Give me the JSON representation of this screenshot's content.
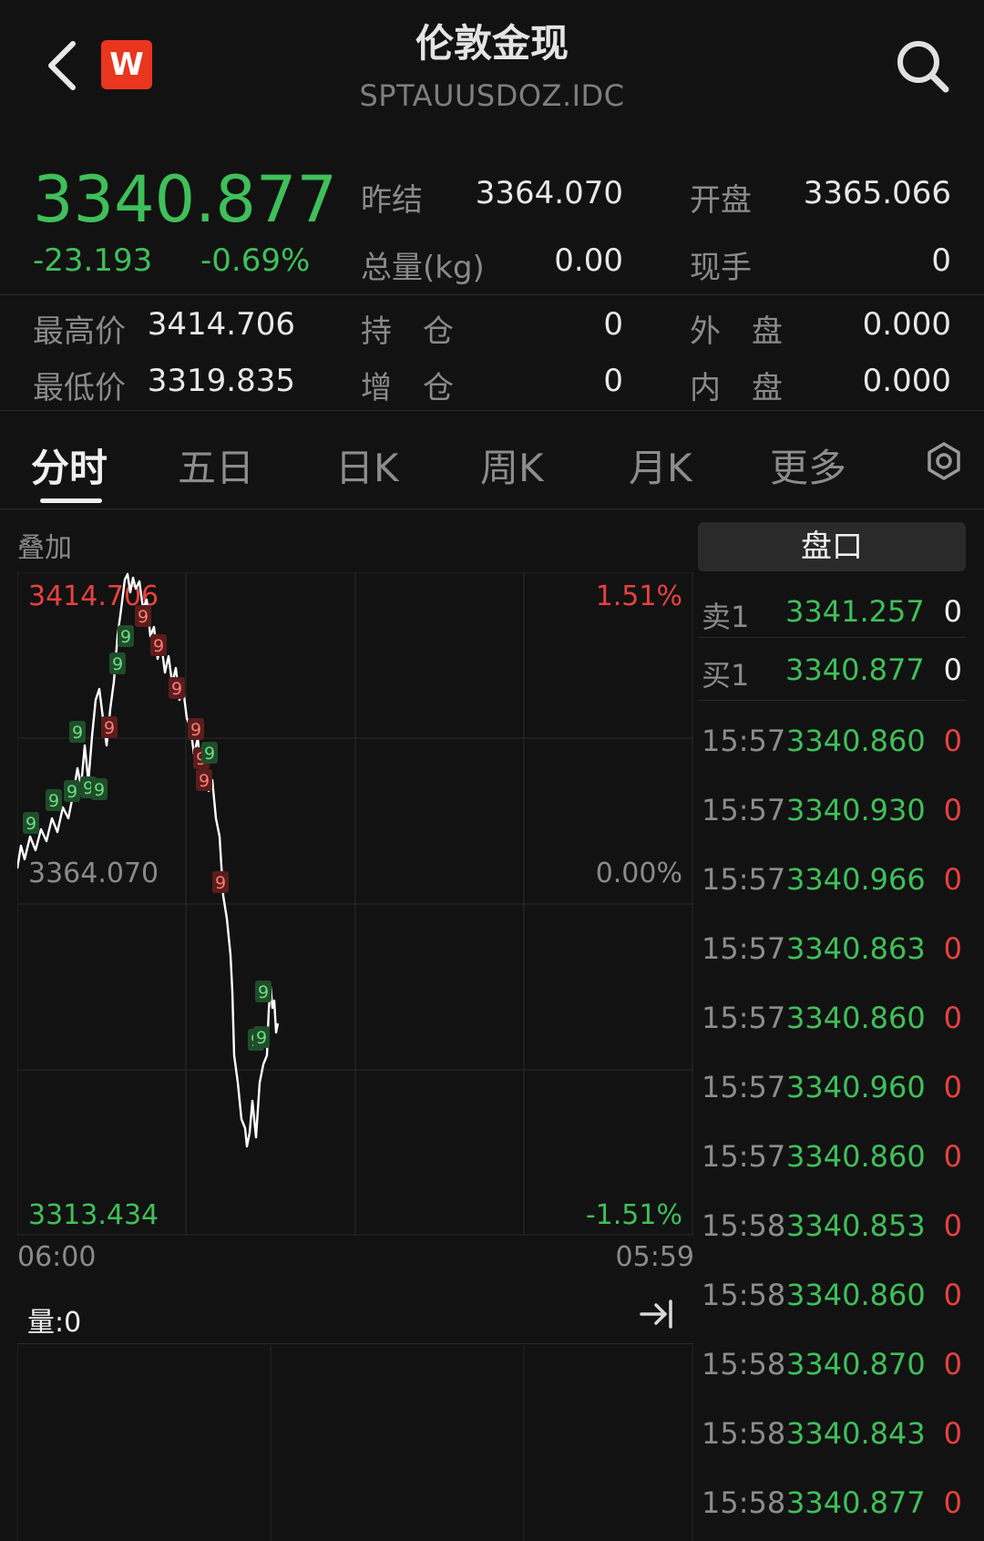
{
  "header": {
    "title": "伦敦金现",
    "subtitle": "SPTAUUSDOZ.IDC",
    "logo_text": "W",
    "back_icon": "chevron-left-icon",
    "search_icon": "search-icon"
  },
  "quote": {
    "price": "3340.877",
    "change": "-23.193",
    "change_pct": "-0.69%",
    "rows": [
      {
        "l1": "昨结",
        "v1": "3364.070",
        "l2": "开盘",
        "v2": "3365.066"
      },
      {
        "l1": "总量(kg)",
        "v1": "0.00",
        "l2": "现手",
        "v2": "0"
      }
    ],
    "stats": [
      {
        "l0": "最高价",
        "v0": "3414.706",
        "l1": "持　仓",
        "v1": "0",
        "l2": "外　盘",
        "v2": "0.000"
      },
      {
        "l0": "最低价",
        "v0": "3319.835",
        "l1": "增　仓",
        "v1": "0",
        "l2": "内　盘",
        "v2": "0.000"
      }
    ]
  },
  "tabs": [
    "分时",
    "五日",
    "日K",
    "周K",
    "月K",
    "更多"
  ],
  "active_tab": "分时",
  "settings_icon": "settings-icon",
  "chart": {
    "overlay_label": "叠加",
    "high_price": "3414.706",
    "high_pct": "1.51%",
    "ref_price": "3364.070",
    "ref_pct": "0.00%",
    "low_price": "3313.434",
    "low_pct": "-1.51%",
    "time_start": "06:00",
    "time_end": "05:59",
    "volume_label": "量:0",
    "collapse_icon": "arrow-right-bar-icon",
    "marker_glyph": "9"
  },
  "order_book": {
    "title": "盘口",
    "asks": [
      {
        "label": "卖1",
        "price": "3341.257",
        "vol": "0"
      }
    ],
    "bids": [
      {
        "label": "买1",
        "price": "3340.877",
        "vol": "0"
      }
    ]
  },
  "trades": [
    {
      "time": "15:57",
      "price": "3340.860",
      "vol": "0"
    },
    {
      "time": "15:57",
      "price": "3340.930",
      "vol": "0"
    },
    {
      "time": "15:57",
      "price": "3340.966",
      "vol": "0"
    },
    {
      "time": "15:57",
      "price": "3340.863",
      "vol": "0"
    },
    {
      "time": "15:57",
      "price": "3340.860",
      "vol": "0"
    },
    {
      "time": "15:57",
      "price": "3340.960",
      "vol": "0"
    },
    {
      "time": "15:57",
      "price": "3340.860",
      "vol": "0"
    },
    {
      "time": "15:58",
      "price": "3340.853",
      "vol": "0"
    },
    {
      "time": "15:58",
      "price": "3340.860",
      "vol": "0"
    },
    {
      "time": "15:58",
      "price": "3340.870",
      "vol": "0"
    },
    {
      "time": "15:58",
      "price": "3340.843",
      "vol": "0"
    },
    {
      "time": "15:58",
      "price": "3340.877",
      "vol": "0"
    }
  ],
  "colors": {
    "up": "#e8413f",
    "down": "#3fbf5a",
    "background": "#121212",
    "line": "#ffffff"
  }
}
